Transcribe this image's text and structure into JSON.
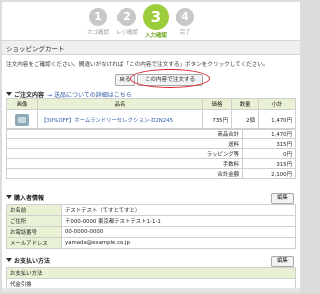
{
  "steps": [
    {
      "num": "1",
      "label": "カゴ確認"
    },
    {
      "num": "2",
      "label": "レジ確認"
    },
    {
      "num": "3",
      "label": "入力確認"
    },
    {
      "num": "4",
      "label": "完了"
    }
  ],
  "page_title": "ショッピングカート",
  "notice": "注文内容をご確認ください。間違いがなければ「この内容で注文する」ボタンをクリックしてください。",
  "buttons": {
    "back": "戻る",
    "submit": "この内容で注文する"
  },
  "order_section": {
    "title": "ご注文内容",
    "link": "→ 送品についての詳細はこちら",
    "headers": [
      "画像",
      "品名",
      "価格",
      "数量",
      "小計"
    ],
    "items": [
      {
        "name": "【30%OFF】ホームランドリーセレクション-D2N245",
        "price": "735円",
        "qty": "2個",
        "subtotal": "1,470円"
      }
    ],
    "summary": [
      {
        "label": "商品合計",
        "value": "1,470円"
      },
      {
        "label": "送料",
        "value": "315円"
      },
      {
        "label": "ラッピング等",
        "value": "0円"
      },
      {
        "label": "手数料",
        "value": "315円"
      },
      {
        "label": "合計金額",
        "value": "2,100円"
      }
    ]
  },
  "buyer_section": {
    "title": "購入者情報",
    "edit": "編集",
    "rows": [
      {
        "label": "お名前",
        "value": "テストテスト（てすとてすと）"
      },
      {
        "label": "ご住所",
        "value": "〒000-0000 東京都テストテスト1-1-1"
      },
      {
        "label": "お電話番号",
        "value": "00-0000-0000"
      },
      {
        "label": "メールアドレス",
        "value": "yamada@example.co.jp"
      }
    ]
  },
  "payment_section": {
    "title": "お支払い方法",
    "edit": "編集",
    "header": "お支払い方法",
    "value": "代金引換"
  }
}
